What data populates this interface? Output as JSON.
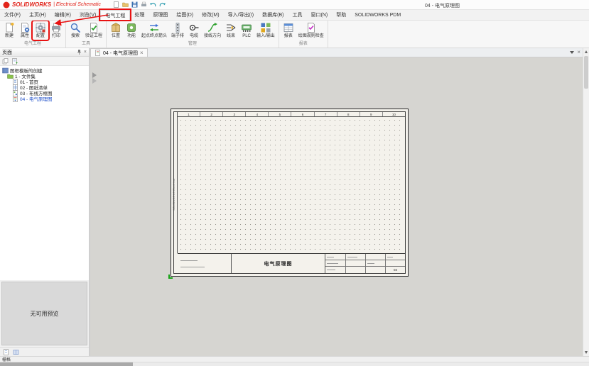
{
  "titlebar": {
    "brand": "SOLIDWORKS",
    "brand_suffix": "| Electrical Schematic",
    "doc_title": "04 - 电气原理图"
  },
  "glyphs": {
    "close": "×"
  },
  "menubar": {
    "items": [
      "文件(F)",
      "主页(H)",
      "编辑(E)",
      "浏览(V)",
      "电气工程",
      "处理",
      "原理图",
      "绘图(D)",
      "修改(M)",
      "导入/导出(I)",
      "数据库(B)",
      "工具",
      "窗口(N)",
      "帮助",
      "SOLIDWORKS PDM"
    ],
    "active": "电气工程"
  },
  "ribbon": {
    "groups": [
      {
        "label": "电气工程",
        "buttons": [
          {
            "label": "新建",
            "icon": "new-document-icon"
          },
          {
            "label": "属性",
            "icon": "properties-icon"
          },
          {
            "label": "配置",
            "icon": "configuration-icon",
            "annotated": true
          },
          {
            "label": "打印",
            "icon": "print-icon"
          }
        ]
      },
      {
        "label": "工具",
        "buttons": [
          {
            "label": "搜索",
            "icon": "search-icon"
          },
          {
            "label": "验证工程",
            "icon": "validate-project-icon"
          }
        ]
      },
      {
        "label": "管理",
        "buttons": [
          {
            "label": "位置",
            "icon": "location-icon"
          },
          {
            "label": "功能",
            "icon": "function-icon"
          },
          {
            "label": "起点终点箭头",
            "icon": "origin-destination-arrow-icon"
          },
          {
            "label": "端子排",
            "icon": "terminal-strip-icon"
          },
          {
            "label": "电缆",
            "icon": "cable-icon"
          },
          {
            "label": "接线方向",
            "icon": "wiring-direction-icon"
          },
          {
            "label": "线束",
            "icon": "harness-icon"
          },
          {
            "label": "PLC",
            "icon": "plc-icon"
          },
          {
            "label": "输入/输出",
            "icon": "inputs-outputs-icon"
          }
        ]
      },
      {
        "label": "报表",
        "buttons": [
          {
            "label": "报表",
            "icon": "reports-icon"
          },
          {
            "label": "绘图规则检查",
            "icon": "drawing-rule-check-icon"
          }
        ]
      }
    ]
  },
  "sidebar": {
    "header": "页面",
    "tree": {
      "project": "图框模板的创建",
      "fileset": "1 - 文件集",
      "pages": [
        {
          "label": "01 - 首页"
        },
        {
          "label": "02 - 图纸清单"
        },
        {
          "label": "03 - 布线方框图"
        },
        {
          "label": "04 - 电气原理图",
          "selected": true
        }
      ]
    },
    "preview_placeholder": "无可用预览"
  },
  "document_tab": {
    "label": "04 - 电气原理图"
  },
  "sheet": {
    "columns": [
      "1",
      "2",
      "3",
      "4",
      "5",
      "6",
      "7",
      "8",
      "9",
      "10"
    ],
    "side_label": "SOLIDWORKS Electrical",
    "title_block_title": "电气原理图",
    "sheet_number": "04"
  },
  "statusbar": {
    "left": "栅格"
  },
  "colors": {
    "brand_red": "#e2231a",
    "annotation_red": "#e81212",
    "selected_blue": "#1f4fc9"
  }
}
